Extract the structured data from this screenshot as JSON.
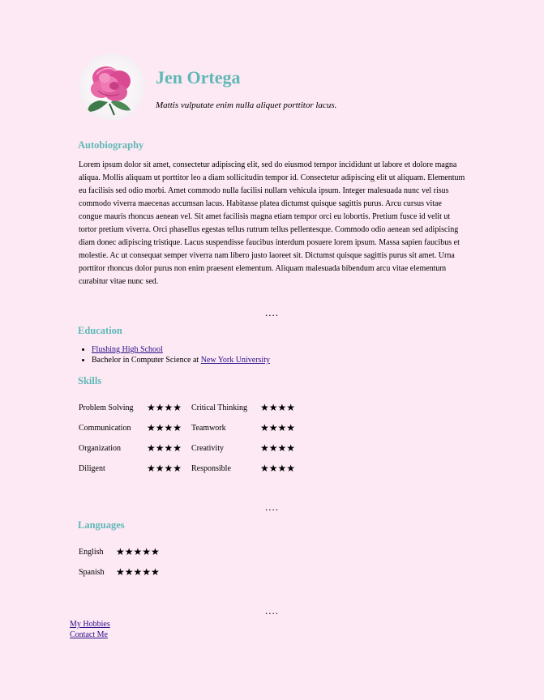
{
  "profile": {
    "name": "Jen Ortega",
    "tagline": "Mattis vulputate enim nulla aliquet porttitor lacus."
  },
  "sections": {
    "autobiography": "Autobiography",
    "education": "Education",
    "skills": "Skills",
    "languages": "Languages"
  },
  "autobiography_text": "Lorem ipsum dolor sit amet, consectetur adipiscing elit, sed do eiusmod tempor incididunt ut labore et dolore magna aliqua. Mollis aliquam ut porttitor leo a diam sollicitudin tempor id. Consectetur adipiscing elit ut aliquam. Elementum eu facilisis sed odio morbi. Amet commodo nulla facilisi nullam vehicula ipsum. Integer malesuada nunc vel risus commodo viverra maecenas accumsan lacus. Habitasse platea dictumst quisque sagittis purus. Arcu cursus vitae congue mauris rhoncus aenean vel. Sit amet facilisis magna etiam tempor orci eu lobortis. Pretium fusce id velit ut tortor pretium viverra. Orci phasellus egestas tellus rutrum tellus pellentesque. Commodo odio aenean sed adipiscing diam donec adipiscing tristique. Lacus suspendisse faucibus interdum posuere lorem ipsum. Massa sapien faucibus et molestie. Ac ut consequat semper viverra nam libero justo laoreet sit. Dictumst quisque sagittis purus sit amet. Urna porttitor rhoncus dolor purus non enim praesent elementum. Aliquam malesuada bibendum arcu vitae elementum curabitur vitae nunc sed.",
  "divider": "....",
  "education": {
    "item1_link": "Flushing High School",
    "item2_text": "Bachelor in Computer Science at ",
    "item2_link": "New York University"
  },
  "skills": [
    {
      "label": "Problem Solving",
      "stars": "★★★★",
      "rating": 4
    },
    {
      "label": "Critical Thinking",
      "stars": "★★★★",
      "rating": 4
    },
    {
      "label": "Communication",
      "stars": "★★★★",
      "rating": 4
    },
    {
      "label": "Teamwork",
      "stars": "★★★★",
      "rating": 4
    },
    {
      "label": "Organization",
      "stars": "★★★★",
      "rating": 4
    },
    {
      "label": "Creativity",
      "stars": "★★★★",
      "rating": 4
    },
    {
      "label": "Diligent",
      "stars": "★★★★",
      "rating": 4
    },
    {
      "label": "Responsible",
      "stars": "★★★★",
      "rating": 4
    }
  ],
  "languages": [
    {
      "label": "English",
      "stars": "★★★★★",
      "rating": 5
    },
    {
      "label": "Spanish",
      "stars": "★★★★★",
      "rating": 5
    }
  ],
  "links": {
    "hobbies": "My Hobbies",
    "contact": "Contact Me"
  },
  "colors": {
    "background": "#fde9f3",
    "heading": "#5fb8b7",
    "link": "#2a0f8a"
  }
}
